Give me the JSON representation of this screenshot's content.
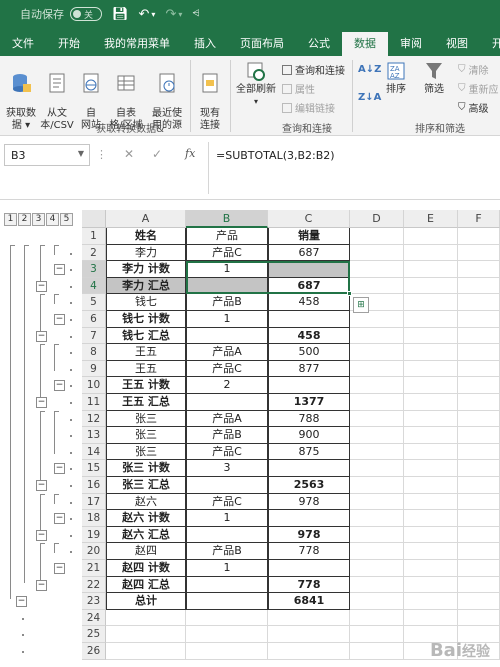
{
  "titlebar": {
    "autosave_label": "自动保存",
    "autosave_state": "关",
    "icons": [
      "save-icon",
      "undo-icon",
      "redo-icon",
      "customize-icon"
    ]
  },
  "ribbon_tabs": [
    "文件",
    "开始",
    "我的常用菜单",
    "插入",
    "页面布局",
    "公式",
    "数据",
    "审阅",
    "视图",
    "开发工"
  ],
  "active_tab": "数据",
  "ribbon": {
    "get_data": "获取数\n据 ▾",
    "from_text": "从文\n本/CSV",
    "from_web": "自\n网站",
    "from_table": "自表\n格/区域",
    "recent_sources": "最近使\n用的源",
    "existing_conn": "现有\n连接",
    "refresh_all": "全部刷新",
    "queries_conn": "查询和连接",
    "properties": "属性",
    "edit_links": "编辑链接",
    "sort_asc": "A↓Z",
    "sort_desc": "Z↓A",
    "sort": "排序",
    "filter": "筛选",
    "clear": "清除",
    "reapply": "重新应",
    "advanced": "高级",
    "group_get": "获取转换数据&",
    "group_queries": "查询和连接",
    "group_sort": "排序和筛选"
  },
  "formula_bar": {
    "name_box": "B3",
    "formula": "=SUBTOTAL(3,B2:B2)",
    "fx_label": "fx"
  },
  "outline_levels": [
    "1",
    "2",
    "3",
    "4",
    "5"
  ],
  "columns": [
    "A",
    "B",
    "C",
    "D",
    "E",
    "F"
  ],
  "rows": [
    {
      "n": "1",
      "a": "姓名",
      "b": "产品",
      "c": "销量",
      "bold": true
    },
    {
      "n": "2",
      "a": "李力",
      "b": "产品C",
      "c": "687"
    },
    {
      "n": "3",
      "a": "李力 计数",
      "b": "1",
      "c": "",
      "bold": true
    },
    {
      "n": "4",
      "a": "李力 汇总",
      "b": "",
      "c": "687",
      "bold": true
    },
    {
      "n": "5",
      "a": "钱七",
      "b": "产品B",
      "c": "458"
    },
    {
      "n": "6",
      "a": "钱七 计数",
      "b": "1",
      "c": "",
      "bold": true
    },
    {
      "n": "7",
      "a": "钱七 汇总",
      "b": "",
      "c": "458",
      "bold": true
    },
    {
      "n": "8",
      "a": "王五",
      "b": "产品A",
      "c": "500"
    },
    {
      "n": "9",
      "a": "王五",
      "b": "产品C",
      "c": "877"
    },
    {
      "n": "10",
      "a": "王五 计数",
      "b": "2",
      "c": "",
      "bold": true
    },
    {
      "n": "11",
      "a": "王五 汇总",
      "b": "",
      "c": "1377",
      "bold": true
    },
    {
      "n": "12",
      "a": "张三",
      "b": "产品A",
      "c": "788"
    },
    {
      "n": "13",
      "a": "张三",
      "b": "产品B",
      "c": "900"
    },
    {
      "n": "14",
      "a": "张三",
      "b": "产品C",
      "c": "875"
    },
    {
      "n": "15",
      "a": "张三 计数",
      "b": "3",
      "c": "",
      "bold": true
    },
    {
      "n": "16",
      "a": "张三 汇总",
      "b": "",
      "c": "2563",
      "bold": true
    },
    {
      "n": "17",
      "a": "赵六",
      "b": "产品C",
      "c": "978"
    },
    {
      "n": "18",
      "a": "赵六 计数",
      "b": "1",
      "c": "",
      "bold": true
    },
    {
      "n": "19",
      "a": "赵六 汇总",
      "b": "",
      "c": "978",
      "bold": true
    },
    {
      "n": "20",
      "a": "赵四",
      "b": "产品B",
      "c": "778"
    },
    {
      "n": "21",
      "a": "赵四 计数",
      "b": "1",
      "c": "",
      "bold": true
    },
    {
      "n": "22",
      "a": "赵四 汇总",
      "b": "",
      "c": "778",
      "bold": true
    },
    {
      "n": "23",
      "a": "总计",
      "b": "",
      "c": "6841",
      "bold": true
    },
    {
      "n": "24",
      "a": "",
      "b": "",
      "c": ""
    },
    {
      "n": "25",
      "a": "",
      "b": "",
      "c": ""
    },
    {
      "n": "26",
      "a": "",
      "b": "",
      "c": ""
    }
  ],
  "selected_cell": "B3",
  "colors": {
    "accent": "#217346",
    "selection_fill": "#c4c4c4"
  },
  "watermark": "Bai经验"
}
